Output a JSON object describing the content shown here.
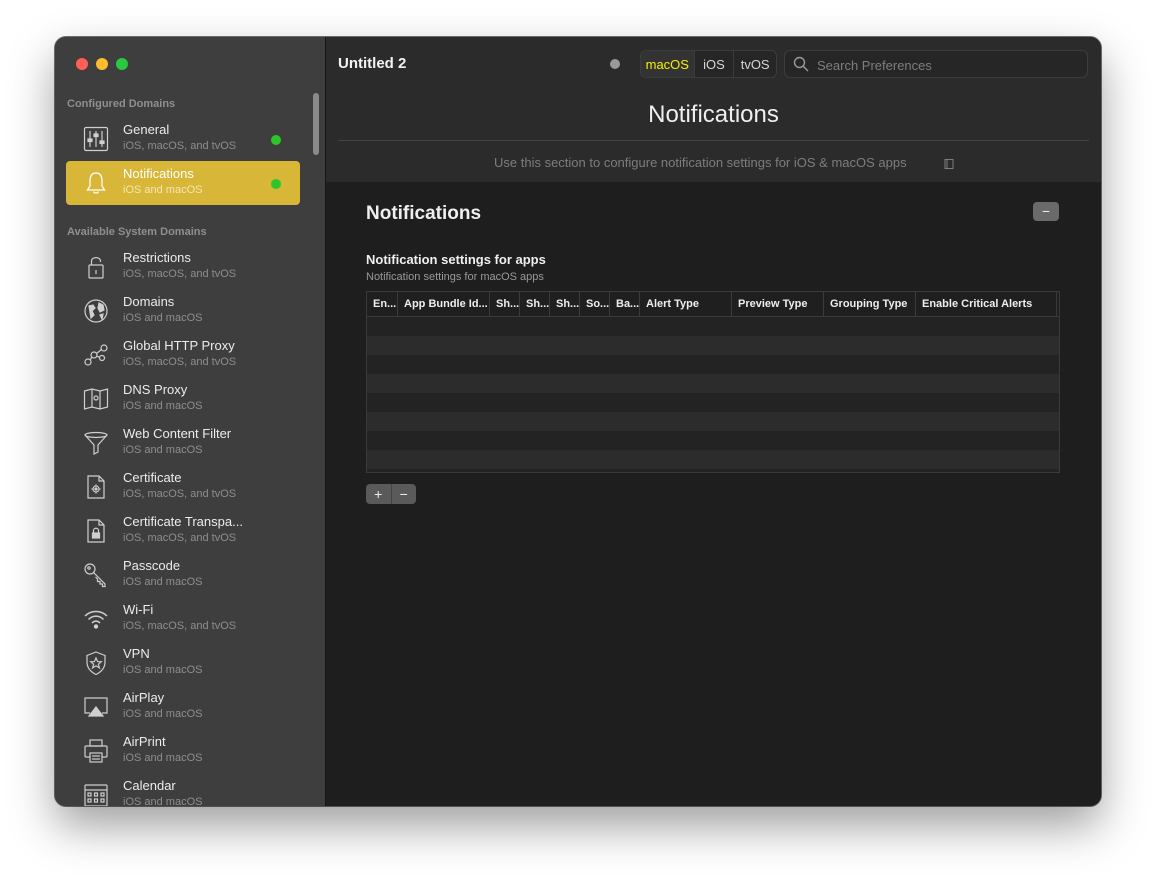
{
  "window": {
    "title": "Untitled 2"
  },
  "platforms": {
    "options": [
      "macOS",
      "iOS",
      "tvOS"
    ],
    "selected": "macOS"
  },
  "search": {
    "placeholder": "Search Preferences"
  },
  "sidebar": {
    "configured_header": "Configured Domains",
    "configured": [
      {
        "title": "General",
        "subtitle": "iOS, macOS, and tvOS",
        "icon": "sliders-icon",
        "configured": true,
        "active": false
      },
      {
        "title": "Notifications",
        "subtitle": "iOS and macOS",
        "icon": "bell-icon",
        "configured": true,
        "active": true
      }
    ],
    "available_header": "Available System Domains",
    "available": [
      {
        "title": "Restrictions",
        "subtitle": "iOS, macOS, and tvOS",
        "icon": "lock-icon"
      },
      {
        "title": "Domains",
        "subtitle": "iOS and macOS",
        "icon": "globe-icon"
      },
      {
        "title": "Global HTTP Proxy",
        "subtitle": "iOS, macOS, and tvOS",
        "icon": "proxy-nodes-icon"
      },
      {
        "title": "DNS Proxy",
        "subtitle": "iOS and macOS",
        "icon": "map-icon"
      },
      {
        "title": "Web Content Filter",
        "subtitle": "iOS and macOS",
        "icon": "funnel-icon"
      },
      {
        "title": "Certificate",
        "subtitle": "iOS, macOS, and tvOS",
        "icon": "certificate-gear-icon"
      },
      {
        "title": "Certificate Transpa...",
        "subtitle": "iOS, macOS, and tvOS",
        "icon": "certificate-lock-icon"
      },
      {
        "title": "Passcode",
        "subtitle": "iOS and macOS",
        "icon": "key-icon"
      },
      {
        "title": "Wi-Fi",
        "subtitle": "iOS, macOS, and tvOS",
        "icon": "wifi-icon"
      },
      {
        "title": "VPN",
        "subtitle": "iOS and macOS",
        "icon": "shield-star-icon"
      },
      {
        "title": "AirPlay",
        "subtitle": "iOS and macOS",
        "icon": "airplay-icon"
      },
      {
        "title": "AirPrint",
        "subtitle": "iOS and macOS",
        "icon": "printer-icon"
      },
      {
        "title": "Calendar",
        "subtitle": "iOS and macOS",
        "icon": "calendar-icon"
      }
    ]
  },
  "page": {
    "title": "Notifications",
    "description": "Use this section to configure notification settings for iOS & macOS apps",
    "section_title": "Notifications",
    "remove_section_label": "−",
    "group_title": "Notification settings for apps",
    "group_subtitle": "Notification settings for macOS apps",
    "table": {
      "columns": [
        "En...",
        "App Bundle Id...",
        "Sh...",
        "Sh...",
        "Sh...",
        "So...",
        "Ba...",
        "Alert Type",
        "Preview Type",
        "Grouping Type",
        "Enable Critical Alerts"
      ],
      "rows": []
    },
    "add_label": "+",
    "remove_label": "−"
  },
  "colors": {
    "accent": "#d7b638",
    "selected_platform": "#f5f200",
    "configured_dot": "#2cc52c"
  }
}
